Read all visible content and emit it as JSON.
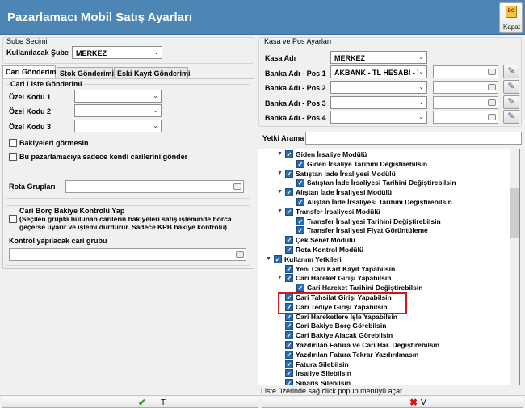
{
  "window": {
    "title": "Pazarlamacı Mobil Satış Ayarları",
    "close_label": "Kapat",
    "close_icon_text": "DO"
  },
  "sube": {
    "group_title": "Sube Secimi",
    "label": "Kullanılacak Şube",
    "value": "MERKEZ"
  },
  "tabs": [
    "Cari Gönderimi",
    "Stok Gönderimi",
    "Eski Kayıt Gönderimi"
  ],
  "cari": {
    "group_title": "Cari Liste Gönderimi",
    "ozel_kodlar": [
      "Özel Kodu 1",
      "Özel Kodu 2",
      "Özel Kodu 3"
    ],
    "checkbox_bakiye": "Bakiyeleri görmesin",
    "checkbox_kendi": "Bu pazarlamacıya sadece kendi carilerini gönder",
    "rota_label": "Rota Grupları",
    "borc_title": "Cari Borç Bakiye Kontrolü Yap",
    "borc_desc_1": "(Seçilen grupta bulunan carilerin bakiyeleri satış işleminde borca",
    "borc_desc_2": "geçerse uyarır ve işlemi durdurur. Sadece KPB bakiye kontrolü)",
    "kontrol_title": "Kontrol yapılacak cari grubu"
  },
  "kasa": {
    "group_title": "Kasa ve Pos Ayarları",
    "kasa_label": "Kasa Adı",
    "kasa_value": "MERKEZ",
    "banka_rows": [
      {
        "label": "Banka Adı - Pos 1",
        "value": "AKBANK - TL HESABI - T"
      },
      {
        "label": "Banka Adı - Pos 2",
        "value": ""
      },
      {
        "label": "Banka Adı - Pos 3",
        "value": ""
      },
      {
        "label": "Banka Adı - Pos 4",
        "value": ""
      }
    ]
  },
  "yetki": {
    "search_label": "Yetki Arama",
    "tree": [
      {
        "lvl": 1,
        "exp": "▼",
        "text": "Giden İrsaliye Modülü"
      },
      {
        "lvl": 2,
        "exp": "",
        "text": "Giden İrsaliye Tarihini Değiştirebilsin"
      },
      {
        "lvl": 1,
        "exp": "▼",
        "text": "Satıştan İade İrsaliyesi Modülü"
      },
      {
        "lvl": 2,
        "exp": "",
        "text": "Satıştan İade İrsaliyesi Tarihini Değiştirebilsin"
      },
      {
        "lvl": 1,
        "exp": "▼",
        "text": "Alıştan İade İrsaliyesi Modülü"
      },
      {
        "lvl": 2,
        "exp": "",
        "text": "Alıştan İade İrsaliyesi Tarihini Değiştirebilsin"
      },
      {
        "lvl": 1,
        "exp": "▼",
        "text": "Transfer İrsaliyesi Modülü"
      },
      {
        "lvl": 2,
        "exp": "",
        "text": "Transfer İrsaliyesi Tarihini Değiştirebilsin"
      },
      {
        "lvl": 2,
        "exp": "",
        "text": "Transfer İrsaliyesi Fiyat Görüntüleme"
      },
      {
        "lvl": 1,
        "exp": "",
        "text": "Çek Senet Modülü"
      },
      {
        "lvl": 1,
        "exp": "",
        "text": "Rota Kontrol Modülü"
      },
      {
        "lvl": 0,
        "exp": "▼",
        "text": "Kullanım Yetkileri"
      },
      {
        "lvl": 1,
        "exp": "",
        "text": "Yeni Cari Kart Kayıt Yapabilsin"
      },
      {
        "lvl": 1,
        "exp": "▼",
        "text": "Cari Hareket Girişi Yapabilsin"
      },
      {
        "lvl": 2,
        "exp": "",
        "text": "Cari Hareket Tarihini Değiştirebilsin"
      },
      {
        "lvl": 1,
        "exp": "",
        "text": "Cari Tahsilat Girişi Yapabilsin"
      },
      {
        "lvl": 1,
        "exp": "",
        "text": "Cari Tediye Girişi Yapabilsin"
      },
      {
        "lvl": 1,
        "exp": "",
        "text": "Cari Hareketlere İşle Yapabilsin"
      },
      {
        "lvl": 1,
        "exp": "",
        "text": "Cari Bakiye Borç Görebilsin"
      },
      {
        "lvl": 1,
        "exp": "",
        "text": "Cari Bakiye Alacak Görebilsin"
      },
      {
        "lvl": 1,
        "exp": "",
        "text": "Yazdırılan Fatura ve Cari Har. Değiştirebilsin"
      },
      {
        "lvl": 1,
        "exp": "",
        "text": "Yazdırılan Fatura Tekrar Yazdırılmasın"
      },
      {
        "lvl": 1,
        "exp": "",
        "text": "Fatura Silebilsin"
      },
      {
        "lvl": 1,
        "exp": "",
        "text": "İrsaliye Silebilsin"
      },
      {
        "lvl": 1,
        "exp": "",
        "text": "Sipariş Silebilsin"
      }
    ],
    "status": "Liste üzerinde sağ click popup menüyü açar"
  },
  "buttons": {
    "ok_label": "T",
    "cancel_label": "V"
  },
  "colors": {
    "title_bar": "#4d86b4",
    "checkbox_blue": "#2b6cb0",
    "highlight_red": "#d9141b"
  }
}
